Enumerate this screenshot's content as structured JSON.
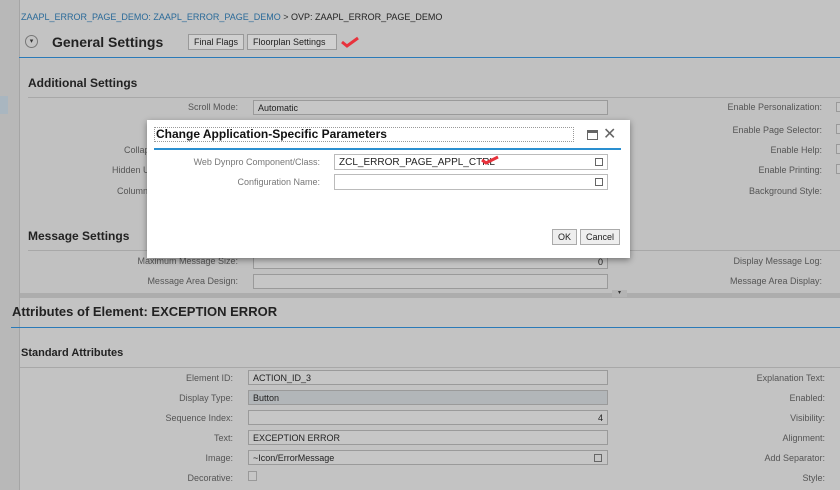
{
  "breadcrumb": {
    "link": "ZAAPL_ERROR_PAGE_DEMO: ZAAPL_ERROR_PAGE_DEMO",
    "separator": ">",
    "current": "OVP: ZAAPL_ERROR_PAGE_DEMO"
  },
  "header": {
    "title": "General Settings",
    "buttons": [
      "Final Flags",
      "Floorplan Settings"
    ]
  },
  "additional": {
    "title": "Additional Settings",
    "scroll_mode_label": "Scroll Mode:",
    "scroll_mode_value": "Automatic",
    "left_labels": [
      "Collap",
      "Hidden U",
      "Column"
    ],
    "right_labels": [
      "Enable Personalization:",
      "Enable Page Selector:",
      "Enable Help:",
      "Enable Printing:",
      "Background Style:"
    ]
  },
  "message": {
    "title": "Message Settings",
    "max_size_label": "Maximum Message Size:",
    "max_size_value": "0",
    "area_design_label": "Message Area Design:",
    "log_label": "Display Message Log:",
    "area_display_label": "Message Area Display:"
  },
  "attributes": {
    "title": "Attributes of Element: EXCEPTION ERROR",
    "section": "Standard Attributes",
    "rows": [
      {
        "label": "Element ID:",
        "value": "ACTION_ID_3"
      },
      {
        "label": "Display Type:",
        "value": "Button"
      },
      {
        "label": "Sequence Index:",
        "value": "4"
      },
      {
        "label": "Text:",
        "value": "EXCEPTION ERROR"
      },
      {
        "label": "Image:",
        "value": "~Icon/ErrorMessage"
      },
      {
        "label": "Decorative:",
        "value": ""
      }
    ],
    "right_labels": [
      "Explanation Text:",
      "Enabled:",
      "Visibility:",
      "Alignment:",
      "Add Separator:",
      "Style:"
    ]
  },
  "dialog": {
    "title": "Change Application-Specific Parameters",
    "component_label": "Web Dynpro Component/Class:",
    "component_value": "ZCL_ERROR_PAGE_APPL_CTRL",
    "config_label": "Configuration Name:",
    "config_value": "",
    "ok": "OK",
    "cancel": "Cancel"
  },
  "colors": {
    "accent": "#2a7ab8",
    "check": "#e8323c"
  }
}
